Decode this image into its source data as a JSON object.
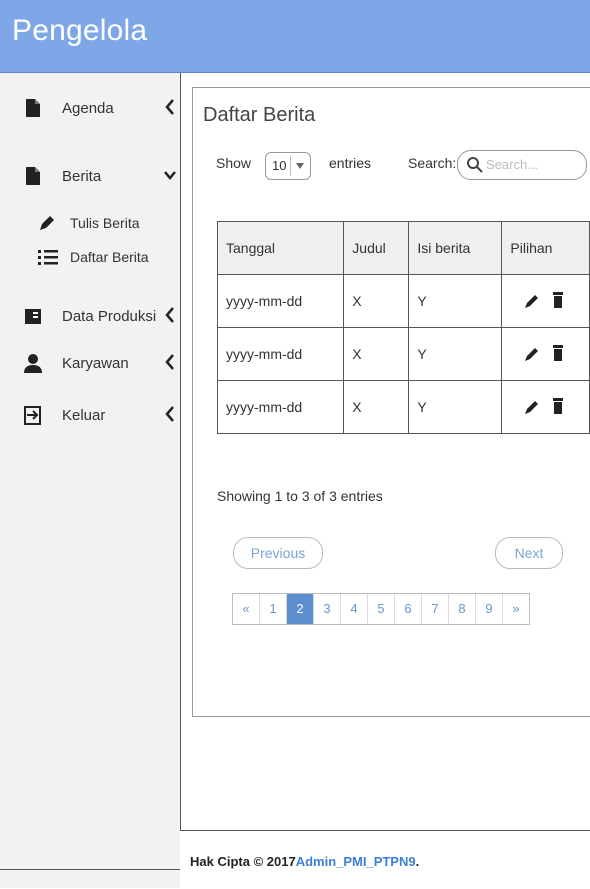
{
  "app": {
    "title": "Pengelola"
  },
  "sidebar": {
    "items": [
      {
        "label": "Agenda",
        "icon": "file-icon"
      },
      {
        "label": "Berita",
        "icon": "file-icon"
      },
      {
        "label": "Data Produksi",
        "icon": "book-icon"
      },
      {
        "label": "Karyawan",
        "icon": "user-icon"
      },
      {
        "label": "Keluar",
        "icon": "logout-icon"
      }
    ],
    "submenu": [
      {
        "label": "Tulis Berita",
        "icon": "pencil-icon"
      },
      {
        "label": "Daftar Berita",
        "icon": "list-icon"
      }
    ]
  },
  "main": {
    "title": "Daftar Berita",
    "show_label": "Show",
    "entries_value": "10",
    "entries_label": "entries",
    "search_label": "Search:",
    "search_placeholder": "Search...",
    "table": {
      "headers": [
        "Tanggal",
        "Judul",
        "Isi berita",
        "Pilihan"
      ],
      "rows": [
        [
          "yyyy-mm-dd",
          "X",
          "Y"
        ],
        [
          "yyyy-mm-dd",
          "X",
          "Y"
        ],
        [
          "yyyy-mm-dd",
          "X",
          "Y"
        ]
      ]
    },
    "info": "Showing 1 to 3 of 3 entries",
    "previous": "Previous",
    "next": "Next",
    "pages": [
      "«",
      "1",
      "2",
      "3",
      "4",
      "5",
      "6",
      "7",
      "8",
      "9",
      "»"
    ],
    "active_page": "2"
  },
  "footer": {
    "text": "Hak Cipta © 2017",
    "link": "Admin_PMI_PTPN9",
    "suffix": "."
  },
  "colors": {
    "header": "#7da7e6",
    "link": "#3c7fd6",
    "active_page": "#5b8fd0"
  }
}
